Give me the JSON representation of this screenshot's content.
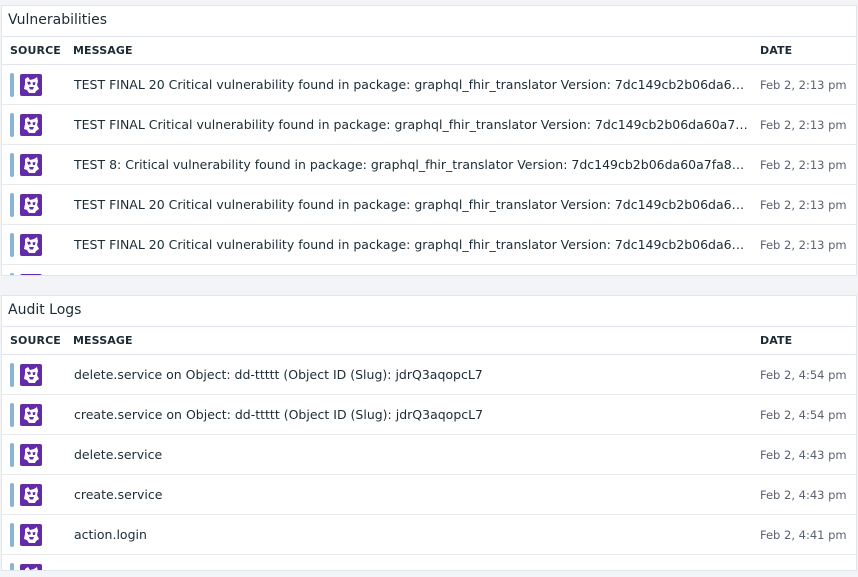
{
  "vulnerabilities": {
    "title": "Vulnerabilities",
    "columns": {
      "source": "SOURCE",
      "message": "MESSAGE",
      "date": "DATE"
    },
    "rows": [
      {
        "source_icon": "datadog-logo-icon",
        "message": "TEST FINAL 20 Critical vulnerability found in package: graphql_fhir_translator Version: 7dc149cb2b06da60a7f…",
        "date": "Feb 2, 2:13 pm"
      },
      {
        "source_icon": "datadog-logo-icon",
        "message": "TEST FINAL Critical vulnerability found in package: graphql_fhir_translator Version: 7dc149cb2b06da60a7fa8…",
        "date": "Feb 2, 2:13 pm"
      },
      {
        "source_icon": "datadog-logo-icon",
        "message": "TEST 8: Critical vulnerability found in package: graphql_fhir_translator Version: 7dc149cb2b06da60a7fa87b2…",
        "date": "Feb 2, 2:13 pm"
      },
      {
        "source_icon": "datadog-logo-icon",
        "message": "TEST FINAL 20 Critical vulnerability found in package: graphql_fhir_translator Version: 7dc149cb2b06da60a7f…",
        "date": "Feb 2, 2:13 pm"
      },
      {
        "source_icon": "datadog-logo-icon",
        "message": "TEST FINAL 20 Critical vulnerability found in package: graphql_fhir_translator Version: 7dc149cb2b06da60a7f…",
        "date": "Feb 2, 2:13 pm"
      }
    ]
  },
  "audit_logs": {
    "title": "Audit Logs",
    "columns": {
      "source": "SOURCE",
      "message": "MESSAGE",
      "date": "DATE"
    },
    "rows": [
      {
        "source_icon": "datadog-logo-icon",
        "message": "delete.service on Object: dd-ttttt (Object ID (Slug): jdrQ3aqopcL7",
        "date": "Feb 2, 4:54 pm"
      },
      {
        "source_icon": "datadog-logo-icon",
        "message": "create.service on Object: dd-ttttt (Object ID (Slug): jdrQ3aqopcL7",
        "date": "Feb 2, 4:54 pm"
      },
      {
        "source_icon": "datadog-logo-icon",
        "message": "delete.service",
        "date": "Feb 2, 4:43 pm"
      },
      {
        "source_icon": "datadog-logo-icon",
        "message": "create.service",
        "date": "Feb 2, 4:43 pm"
      },
      {
        "source_icon": "datadog-logo-icon",
        "message": "action.login",
        "date": "Feb 2, 4:41 pm"
      }
    ]
  },
  "colors": {
    "brand_purple": "#632ca6",
    "status_bar": "#8ab4d6",
    "border": "#e2e5ed"
  }
}
